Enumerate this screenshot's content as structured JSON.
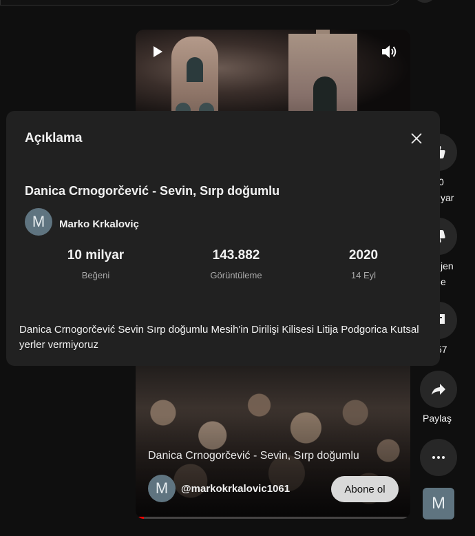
{
  "player": {
    "title": "Danica Crnogorčević - Sevin, Sırp doğumlu",
    "channel_avatar_letter": "M",
    "channel_handle": "@markokrkalovic1061",
    "subscribe_label": "Abone ol",
    "progress": 0.03
  },
  "side_actions": {
    "like_count_partial": "0",
    "like_label_partial": "yar",
    "dislike_label_partial_1": "jen",
    "dislike_label_partial_2": "e",
    "comments_partial": "57",
    "share_label": "Paylaş",
    "thumb_letter": "M"
  },
  "description_panel": {
    "heading": "Açıklama",
    "video_title": "Danica Crnogorčević - Sevin, Sırp doğumlu",
    "author_avatar_letter": "M",
    "author_name": "Marko Krkaloviç",
    "stats": [
      {
        "value": "10 milyar",
        "label": "Beğeni"
      },
      {
        "value": "143.882",
        "label": "Görüntüleme"
      },
      {
        "value": "2020",
        "label": "14 Eyl"
      }
    ],
    "body": "Danica Crnogorčević Sevin Sırp doğumlu Mesih'in Dirilişi Kilisesi Litija Podgorica Kutsal yerler vermiyoruz"
  },
  "colors": {
    "background": "#0f0f0f",
    "panel": "#212121",
    "button_bg": "#272727",
    "subscribe_bg": "#d9d9d9",
    "progress": "#ff0000"
  }
}
